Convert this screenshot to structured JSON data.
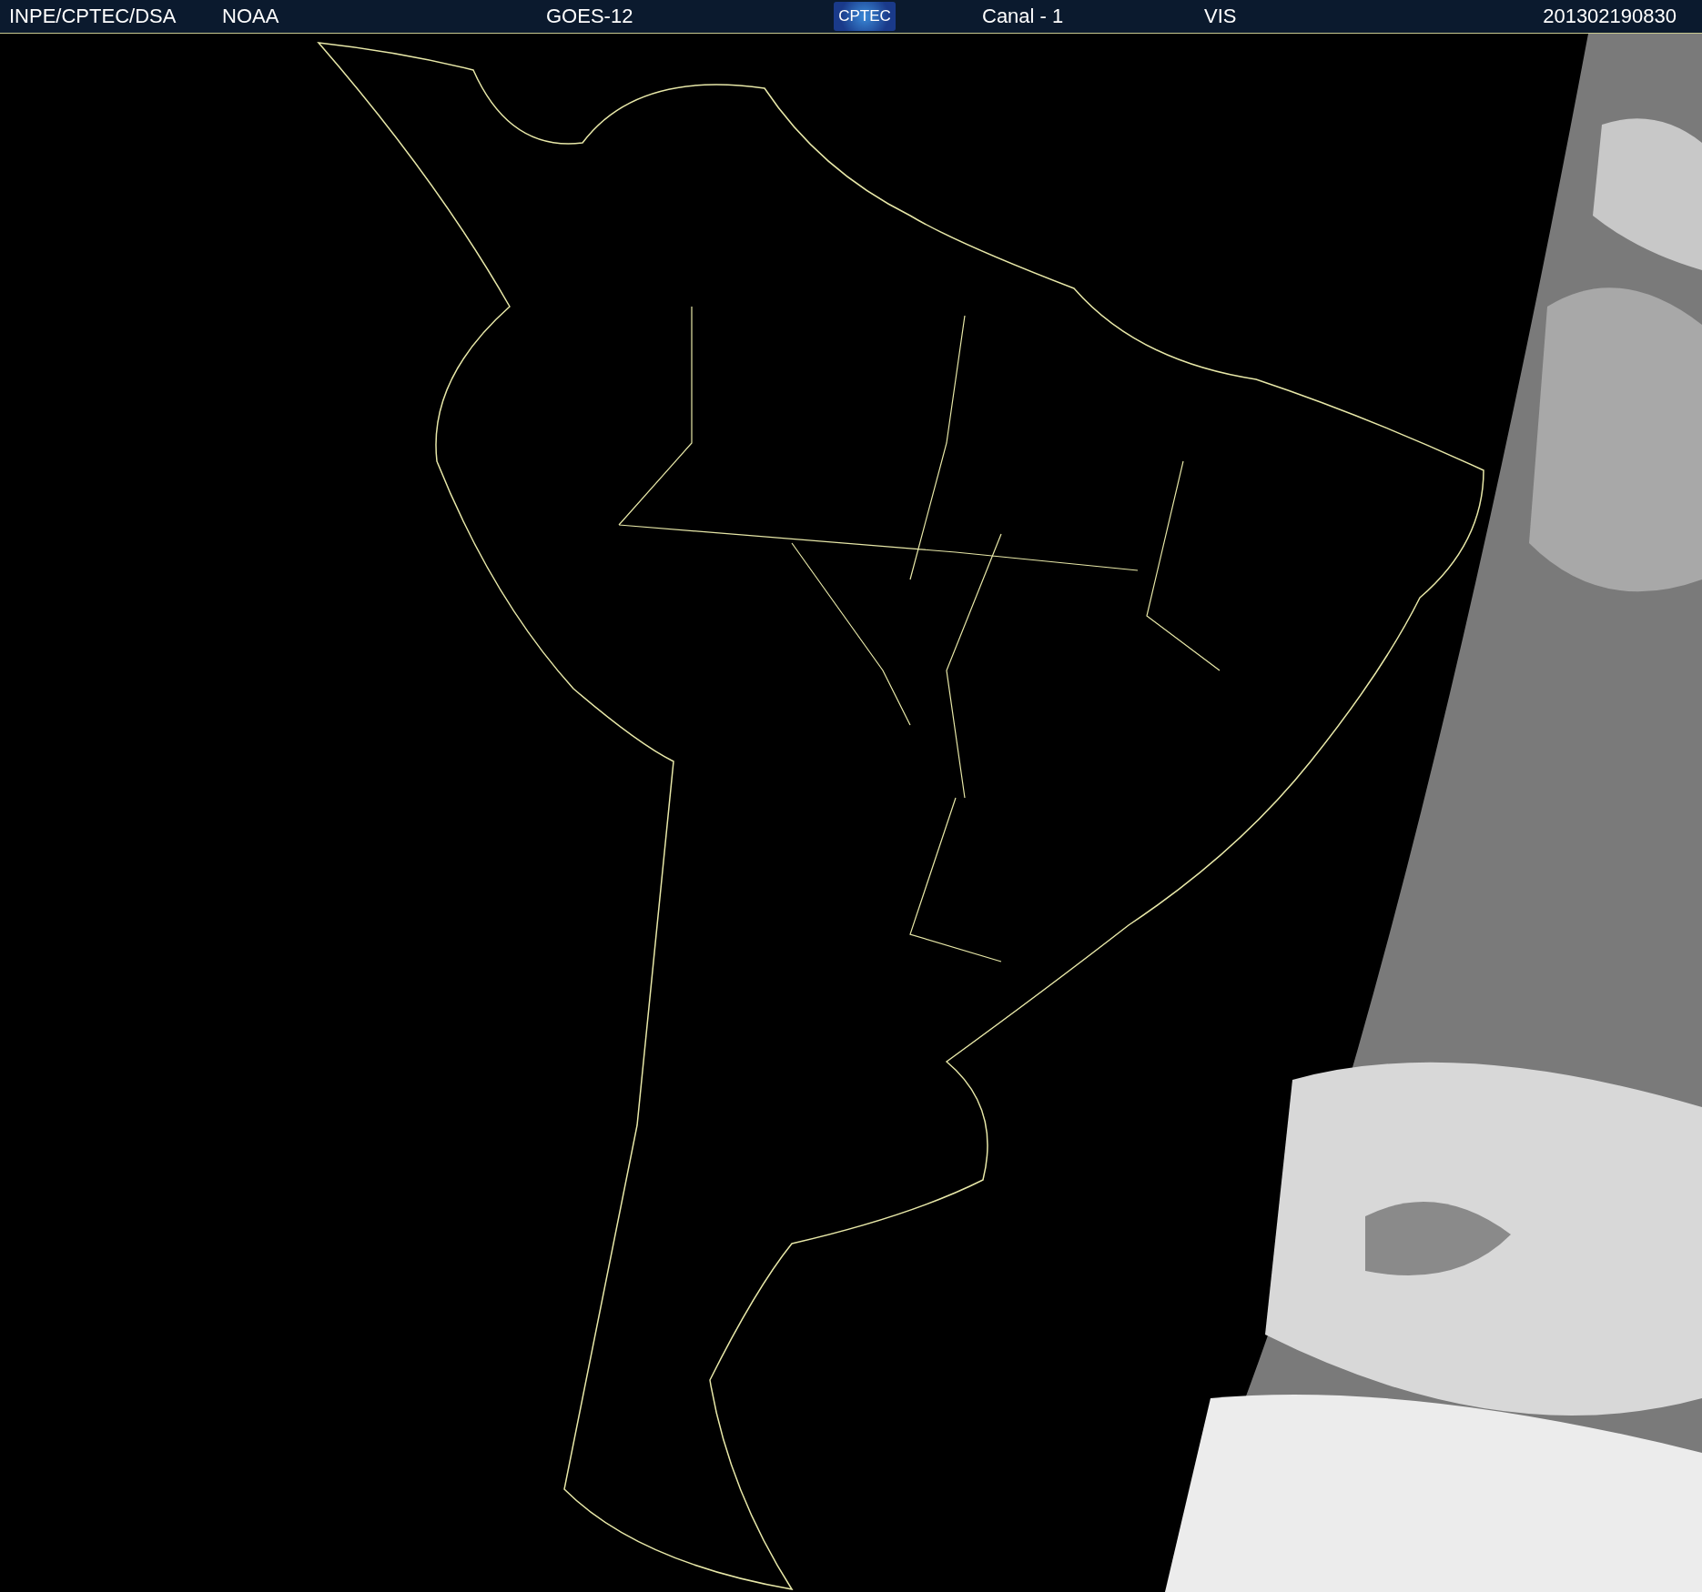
{
  "header": {
    "source": "INPE/CPTEC/DSA",
    "agency": "NOAA",
    "satellite": "GOES-12",
    "logo": "CPTEC",
    "channel": "Canal - 1",
    "band": "VIS",
    "timestamp": "201302190830"
  }
}
